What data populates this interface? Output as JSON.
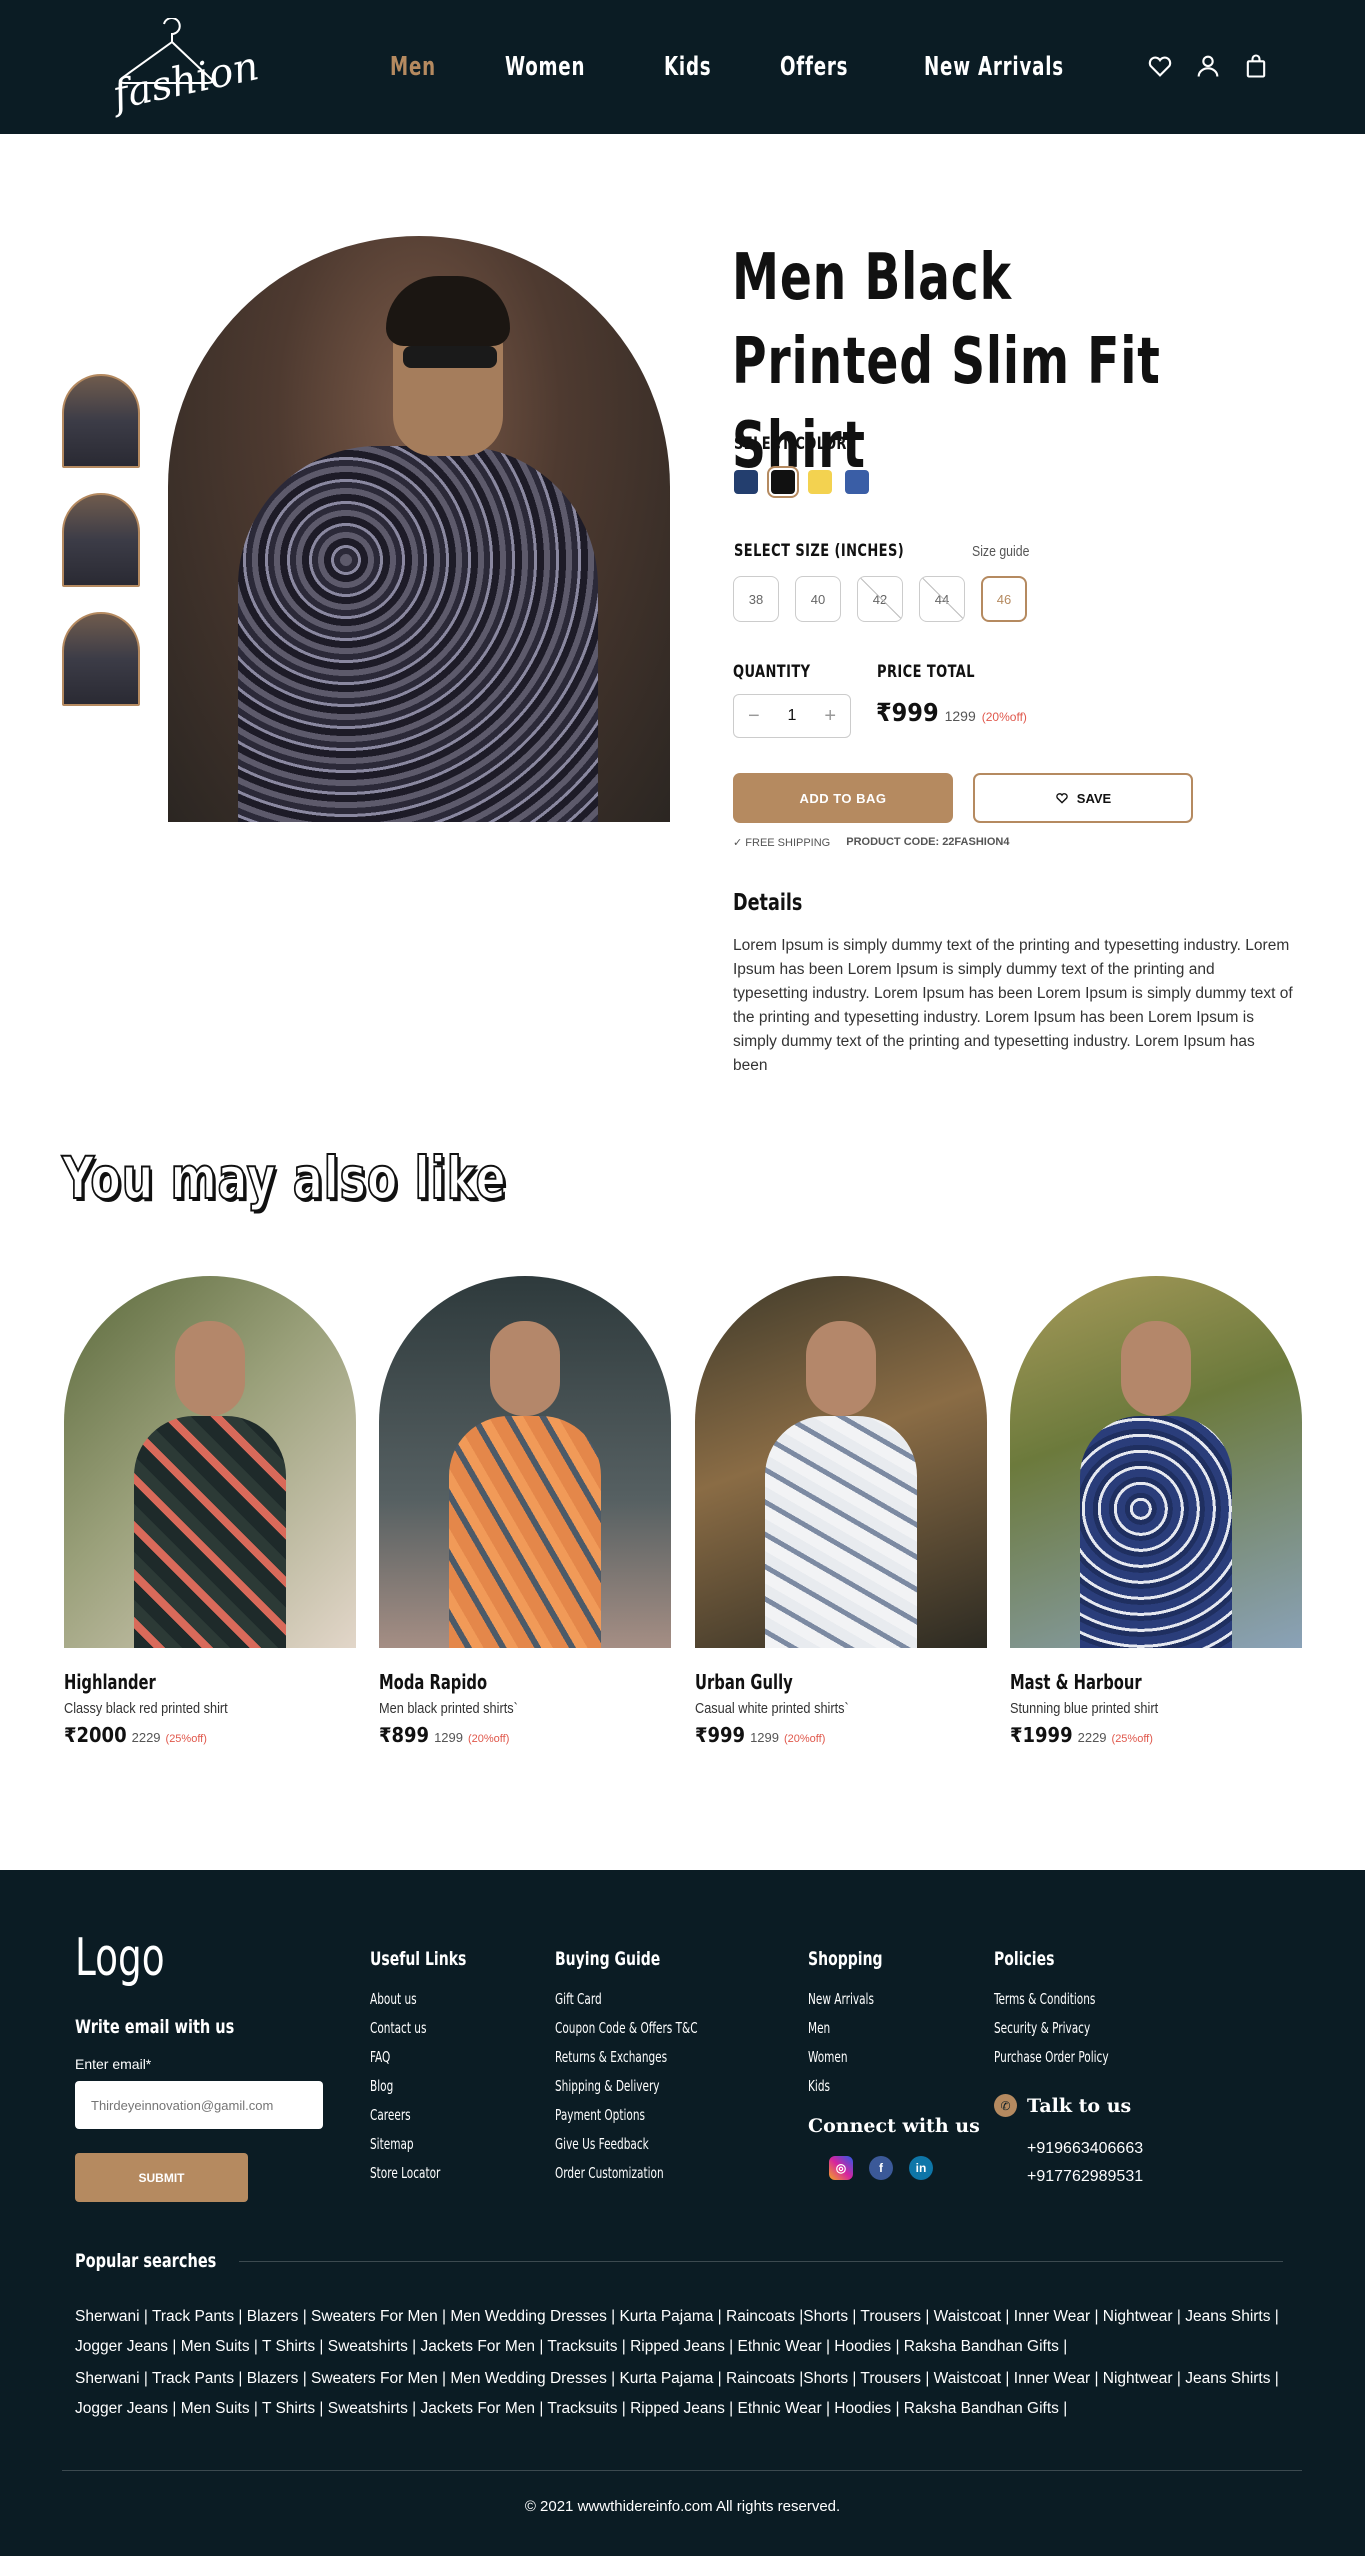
{
  "header": {
    "logo_text": "fashion",
    "nav": [
      "Men",
      "Women",
      "Kids",
      "Offers",
      "New Arrivals"
    ],
    "active_nav": "Men"
  },
  "product": {
    "title": "Men Black Printed Slim Fit Shirt",
    "select_color_label": "SELECT COLOR",
    "colors": [
      "#233e6e",
      "#111111",
      "#f3d250",
      "#3a5ea6"
    ],
    "selected_color_index": 1,
    "select_size_label": "SELECT SIZE (INCHES)",
    "size_guide": "Size guide",
    "sizes": [
      {
        "label": "38",
        "available": true
      },
      {
        "label": "40",
        "available": true
      },
      {
        "label": "42",
        "available": false
      },
      {
        "label": "44",
        "available": false
      },
      {
        "label": "46",
        "available": true,
        "selected": true
      }
    ],
    "quantity_label": "QUANTITY",
    "quantity": "1",
    "price_total_label": "PRICE TOTAL",
    "price": "₹999",
    "price_was": "1299",
    "discount": "(20%off)",
    "add_to_bag": "ADD TO BAG",
    "save": "SAVE",
    "free_shipping": "FREE SHIPPING",
    "product_code": "PRODUCT CODE: 22FASHION4",
    "details_heading": "Details",
    "details_text": "Lorem Ipsum is simply dummy text of the printing and typesetting industry. Lorem Ipsum has been Lorem Ipsum is simply dummy text of the printing and typesetting industry. Lorem Ipsum has been Lorem Ipsum is simply dummy text of the printing and typesetting industry. Lorem Ipsum has been Lorem Ipsum is simply dummy text of the printing and typesetting industry. Lorem Ipsum has been"
  },
  "related": {
    "heading": "You may also like",
    "items": [
      {
        "name": "Highlander",
        "desc": "Classy black red printed shirt",
        "price": "₹2000",
        "was": "2229",
        "off": "(25%off)"
      },
      {
        "name": "Moda Rapido",
        "desc": "Men black printed shirts`",
        "price": "₹899",
        "was": "1299",
        "off": "(20%off)"
      },
      {
        "name": "Urban Gully",
        "desc": "Casual white printed shirts`",
        "price": "₹999",
        "was": "1299",
        "off": "(20%off)"
      },
      {
        "name": "Mast & Harbour",
        "desc": "Stunning blue printed shirt",
        "price": "₹1999",
        "was": "2229",
        "off": "(25%off)"
      }
    ]
  },
  "footer": {
    "logo": "Logo",
    "write_email": "Write email with us",
    "enter_email_label": "Enter email*",
    "email_placeholder": "Thirdeyeinnovation@gamil.com",
    "submit": "SUBMIT",
    "useful_links": {
      "title": "Useful Links",
      "items": [
        "About us",
        "Contact us",
        "FAQ",
        "Blog",
        "Careers",
        "Sitemap",
        "Store Locator"
      ]
    },
    "buying_guide": {
      "title": "Buying Guide",
      "items": [
        "Gift Card",
        "Coupon Code & Offers T&C",
        "Returns & Exchanges",
        "Shipping & Delivery",
        "Payment Options",
        "Give Us Feedback",
        "Order Customization"
      ]
    },
    "shopping": {
      "title": "Shopping",
      "items": [
        "New Arrivals",
        "Men",
        "Women",
        "Kids"
      ]
    },
    "policies": {
      "title": "Policies",
      "items": [
        "Terms & Conditions",
        "Security & Privacy",
        "Purchase Order Policy"
      ]
    },
    "connect": "Connect with us",
    "talk": "Talk to us",
    "phones": [
      "+919663406663",
      "+917762989531"
    ],
    "popular_heading": "Popular searches",
    "popular_line1": "Sherwani | Track Pants | Blazers | Sweaters For Men | Men Wedding Dresses | Kurta Pajama | Raincoats |Shorts | Trousers | Waistcoat | Inner Wear | Nightwear | Jeans Shirts | Jogger Jeans | Men Suits | T Shirts | Sweatshirts | Jackets For Men | Tracksuits | Ripped Jeans | Ethnic Wear | Hoodies | Raksha Bandhan Gifts |",
    "popular_line2": "Sherwani | Track Pants | Blazers | Sweaters For Men | Men Wedding Dresses | Kurta Pajama | Raincoats |Shorts | Trousers | Waistcoat | Inner Wear | Nightwear | Jeans Shirts | Jogger Jeans | Men Suits | T Shirts | Sweatshirts | Jackets For Men | Tracksuits | Ripped Jeans | Ethnic Wear | Hoodies | Raksha Bandhan Gifts |",
    "copyright": "© 2021 wwwthidereinfo.com All rights reserved."
  }
}
